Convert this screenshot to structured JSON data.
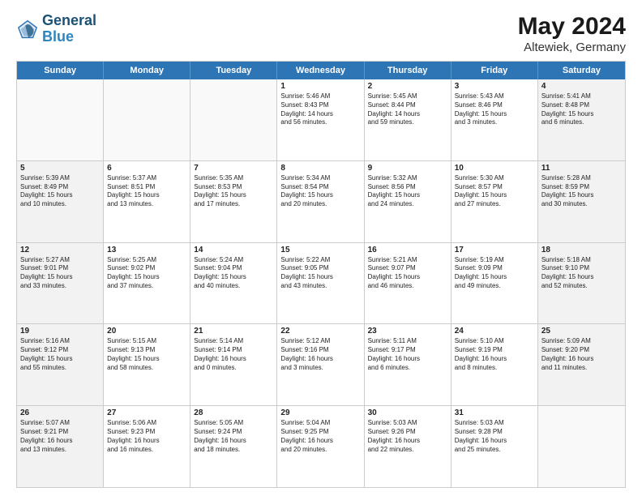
{
  "logo": {
    "line1": "General",
    "line2": "Blue"
  },
  "title": "May 2024",
  "subtitle": "Altewiek, Germany",
  "days": [
    "Sunday",
    "Monday",
    "Tuesday",
    "Wednesday",
    "Thursday",
    "Friday",
    "Saturday"
  ],
  "rows": [
    [
      {
        "day": "",
        "info": ""
      },
      {
        "day": "",
        "info": ""
      },
      {
        "day": "",
        "info": ""
      },
      {
        "day": "1",
        "info": "Sunrise: 5:46 AM\nSunset: 8:43 PM\nDaylight: 14 hours\nand 56 minutes."
      },
      {
        "day": "2",
        "info": "Sunrise: 5:45 AM\nSunset: 8:44 PM\nDaylight: 14 hours\nand 59 minutes."
      },
      {
        "day": "3",
        "info": "Sunrise: 5:43 AM\nSunset: 8:46 PM\nDaylight: 15 hours\nand 3 minutes."
      },
      {
        "day": "4",
        "info": "Sunrise: 5:41 AM\nSunset: 8:48 PM\nDaylight: 15 hours\nand 6 minutes."
      }
    ],
    [
      {
        "day": "5",
        "info": "Sunrise: 5:39 AM\nSunset: 8:49 PM\nDaylight: 15 hours\nand 10 minutes."
      },
      {
        "day": "6",
        "info": "Sunrise: 5:37 AM\nSunset: 8:51 PM\nDaylight: 15 hours\nand 13 minutes."
      },
      {
        "day": "7",
        "info": "Sunrise: 5:35 AM\nSunset: 8:53 PM\nDaylight: 15 hours\nand 17 minutes."
      },
      {
        "day": "8",
        "info": "Sunrise: 5:34 AM\nSunset: 8:54 PM\nDaylight: 15 hours\nand 20 minutes."
      },
      {
        "day": "9",
        "info": "Sunrise: 5:32 AM\nSunset: 8:56 PM\nDaylight: 15 hours\nand 24 minutes."
      },
      {
        "day": "10",
        "info": "Sunrise: 5:30 AM\nSunset: 8:57 PM\nDaylight: 15 hours\nand 27 minutes."
      },
      {
        "day": "11",
        "info": "Sunrise: 5:28 AM\nSunset: 8:59 PM\nDaylight: 15 hours\nand 30 minutes."
      }
    ],
    [
      {
        "day": "12",
        "info": "Sunrise: 5:27 AM\nSunset: 9:01 PM\nDaylight: 15 hours\nand 33 minutes."
      },
      {
        "day": "13",
        "info": "Sunrise: 5:25 AM\nSunset: 9:02 PM\nDaylight: 15 hours\nand 37 minutes."
      },
      {
        "day": "14",
        "info": "Sunrise: 5:24 AM\nSunset: 9:04 PM\nDaylight: 15 hours\nand 40 minutes."
      },
      {
        "day": "15",
        "info": "Sunrise: 5:22 AM\nSunset: 9:05 PM\nDaylight: 15 hours\nand 43 minutes."
      },
      {
        "day": "16",
        "info": "Sunrise: 5:21 AM\nSunset: 9:07 PM\nDaylight: 15 hours\nand 46 minutes."
      },
      {
        "day": "17",
        "info": "Sunrise: 5:19 AM\nSunset: 9:09 PM\nDaylight: 15 hours\nand 49 minutes."
      },
      {
        "day": "18",
        "info": "Sunrise: 5:18 AM\nSunset: 9:10 PM\nDaylight: 15 hours\nand 52 minutes."
      }
    ],
    [
      {
        "day": "19",
        "info": "Sunrise: 5:16 AM\nSunset: 9:12 PM\nDaylight: 15 hours\nand 55 minutes."
      },
      {
        "day": "20",
        "info": "Sunrise: 5:15 AM\nSunset: 9:13 PM\nDaylight: 15 hours\nand 58 minutes."
      },
      {
        "day": "21",
        "info": "Sunrise: 5:14 AM\nSunset: 9:14 PM\nDaylight: 16 hours\nand 0 minutes."
      },
      {
        "day": "22",
        "info": "Sunrise: 5:12 AM\nSunset: 9:16 PM\nDaylight: 16 hours\nand 3 minutes."
      },
      {
        "day": "23",
        "info": "Sunrise: 5:11 AM\nSunset: 9:17 PM\nDaylight: 16 hours\nand 6 minutes."
      },
      {
        "day": "24",
        "info": "Sunrise: 5:10 AM\nSunset: 9:19 PM\nDaylight: 16 hours\nand 8 minutes."
      },
      {
        "day": "25",
        "info": "Sunrise: 5:09 AM\nSunset: 9:20 PM\nDaylight: 16 hours\nand 11 minutes."
      }
    ],
    [
      {
        "day": "26",
        "info": "Sunrise: 5:07 AM\nSunset: 9:21 PM\nDaylight: 16 hours\nand 13 minutes."
      },
      {
        "day": "27",
        "info": "Sunrise: 5:06 AM\nSunset: 9:23 PM\nDaylight: 16 hours\nand 16 minutes."
      },
      {
        "day": "28",
        "info": "Sunrise: 5:05 AM\nSunset: 9:24 PM\nDaylight: 16 hours\nand 18 minutes."
      },
      {
        "day": "29",
        "info": "Sunrise: 5:04 AM\nSunset: 9:25 PM\nDaylight: 16 hours\nand 20 minutes."
      },
      {
        "day": "30",
        "info": "Sunrise: 5:03 AM\nSunset: 9:26 PM\nDaylight: 16 hours\nand 22 minutes."
      },
      {
        "day": "31",
        "info": "Sunrise: 5:03 AM\nSunset: 9:28 PM\nDaylight: 16 hours\nand 25 minutes."
      },
      {
        "day": "",
        "info": ""
      }
    ]
  ]
}
